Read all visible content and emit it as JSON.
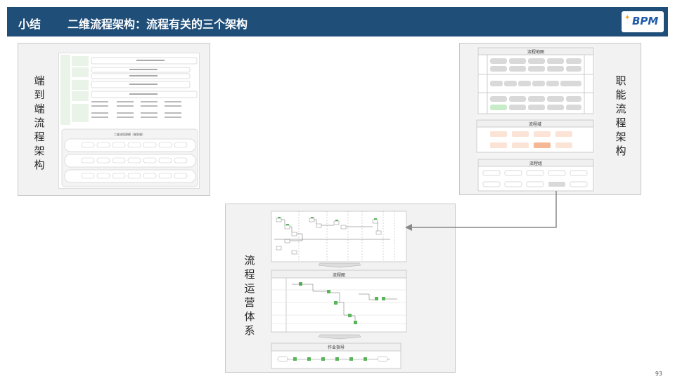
{
  "header": {
    "tag": "小结",
    "title": "二维流程架构：流程有关的三个架构",
    "logo_text": "BPM",
    "background": "#1f4e79"
  },
  "panels": {
    "end_to_end": {
      "label": "端到端流程架构"
    },
    "functional": {
      "label": "职能流程架构"
    },
    "operations": {
      "label": "流程运营体系"
    }
  },
  "thumb_functional": {
    "map_title": "流程地图",
    "domain_title": "流程域",
    "group_title": "流程组"
  },
  "thumb_operations": {
    "chart_title": "流程图",
    "job_title": "作业指导"
  },
  "thumb_e2e": {
    "panel_title": "二维流程建模（端到端）"
  },
  "page_number": "93"
}
